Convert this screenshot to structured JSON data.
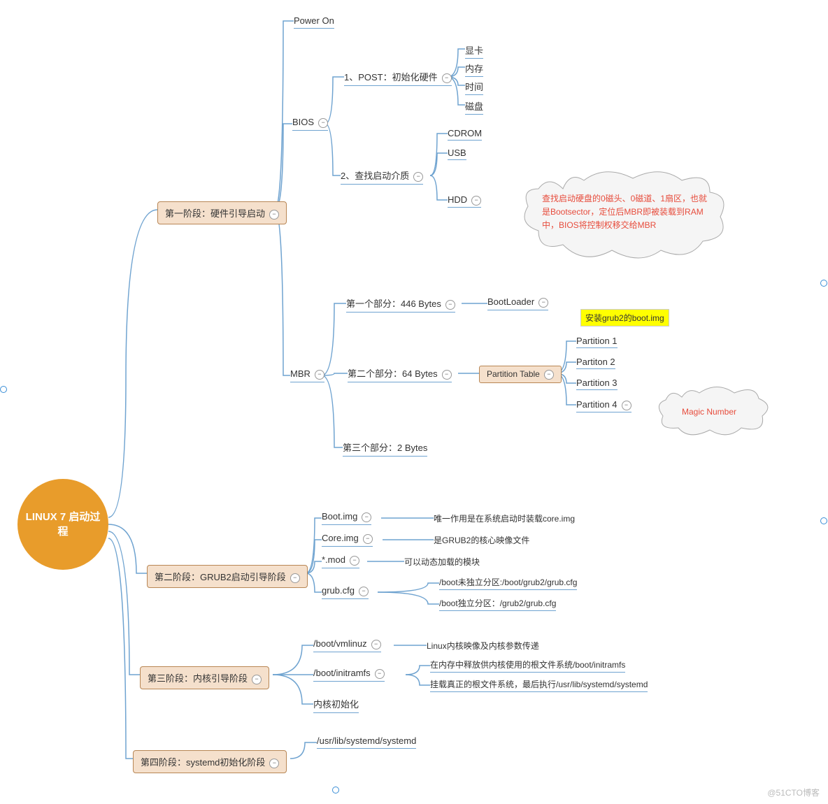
{
  "root": "LINUX 7 启动过程",
  "stage1": {
    "label": "第一阶段：硬件引导启动",
    "powerOn": "Power On",
    "bios": {
      "label": "BIOS",
      "post": {
        "label": "1、POST：初始化硬件",
        "items": [
          "显卡",
          "内存",
          "时间",
          "磁盘"
        ]
      },
      "media": {
        "label": "2、查找启动介质",
        "items": [
          "CDROM",
          "USB",
          "HDD"
        ]
      }
    },
    "hddNote": "查找启动硬盘的0磁头、0磁道、1扇区，也就是Bootsector，定位后MBR即被装载到RAM中，BIOS将控制权移交给MBR",
    "mbr": {
      "label": "MBR",
      "p1": {
        "label": "第一个部分：446 Bytes",
        "boot": "BootLoader",
        "hl": "安装grub2的boot.img"
      },
      "p2": {
        "label": "第二个部分：64 Bytes",
        "table": "Partition Table",
        "items": [
          "Partition 1",
          "Partiton 2",
          "Partition 3",
          "Partition 4"
        ],
        "note": "Magic Number"
      },
      "p3": {
        "label": "第三个部分：2 Bytes"
      }
    }
  },
  "stage2": {
    "label": "第二阶段：GRUB2启动引导阶段",
    "bootImg": {
      "label": "Boot.img",
      "note": "唯一作用是在系统启动时装载core.img"
    },
    "coreImg": {
      "label": "Core.img",
      "note": "是GRUB2的核心映像文件"
    },
    "mod": {
      "label": "*.mod",
      "note": "可以动态加载的模块"
    },
    "cfg": {
      "label": "grub.cfg",
      "a": "/boot未独立分区:/boot/grub2/grub.cfg",
      "b": "/boot独立分区：/grub2/grub.cfg"
    }
  },
  "stage3": {
    "label": "第三阶段：内核引导阶段",
    "vmlinuz": {
      "label": "/boot/vmlinuz",
      "note": "Linux内核映像及内核参数传递"
    },
    "initramfs": {
      "label": "/boot/initramfs",
      "a": "在内存中释放供内核使用的根文件系统/boot/initramfs",
      "b": "挂载真正的根文件系统，最后执行/usr/lib/systemd/systemd"
    },
    "init": "内核初始化"
  },
  "stage4": {
    "label": "第四阶段：systemd初始化阶段",
    "path": "/usr/lib/systemd/systemd"
  },
  "watermark": "@51CTO博客"
}
